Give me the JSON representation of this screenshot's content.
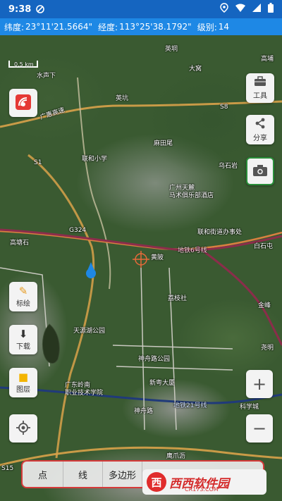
{
  "status_bar": {
    "time": "9:38"
  },
  "coordinates": {
    "lat_label": "纬度:",
    "lat_value": "23°11'21.5664\"",
    "lng_label": "经度:",
    "lng_value": "113°25'38.1792\"",
    "level_label": "级别:",
    "level_value": "14"
  },
  "map": {
    "scale_text": "0.5 km",
    "labels": {
      "yingdong": "英垌",
      "shuishengxia": "水声下",
      "gaopu": "高埔",
      "dawo": "大窝",
      "yingkeng": "英坑",
      "guangshengaosu": "广惠高速",
      "s8": "S8",
      "mamaiwei": "麻田尾",
      "lianhexiaoxue": "联和小学",
      "s1": "S1",
      "wushiyan": "乌石岩",
      "guangzhoutianlu": "广州天麓\n马术俱乐部酒店",
      "g324": "G324",
      "lianhejiedao": "联和街道办事处",
      "gaotangshi": "高塘石",
      "subway6": "地铁6号线",
      "huangpi": "黄陂",
      "baishitun": "白石屯",
      "lizhishe": "荔枝社",
      "jinfeng": "金峰",
      "tianyuan": "天源湖公园",
      "shenzhoujiaoyuan": "神舟路公园",
      "yaoming": "尧明",
      "xinyuedawu": "新粤大厦",
      "guangdongcollege": "广东岭南\n职业技术学院",
      "shenzhoulu": "神舟路",
      "subway21": "地铁21号线",
      "kexuecheng": "科学城",
      "yingzhuji": "鹰爪沥",
      "s15": "S15"
    }
  },
  "buttons": {
    "tools": "工具",
    "share": "分享",
    "annotate": "标绘",
    "download": "下载",
    "layers": "图层",
    "zoom_in": "+",
    "zoom_out": "−"
  },
  "toolbar": {
    "point": "点",
    "line": "线",
    "polygon": "多边形"
  },
  "watermark": {
    "logo": "西",
    "text": "西西软件园",
    "sub": "CR173.COM"
  }
}
